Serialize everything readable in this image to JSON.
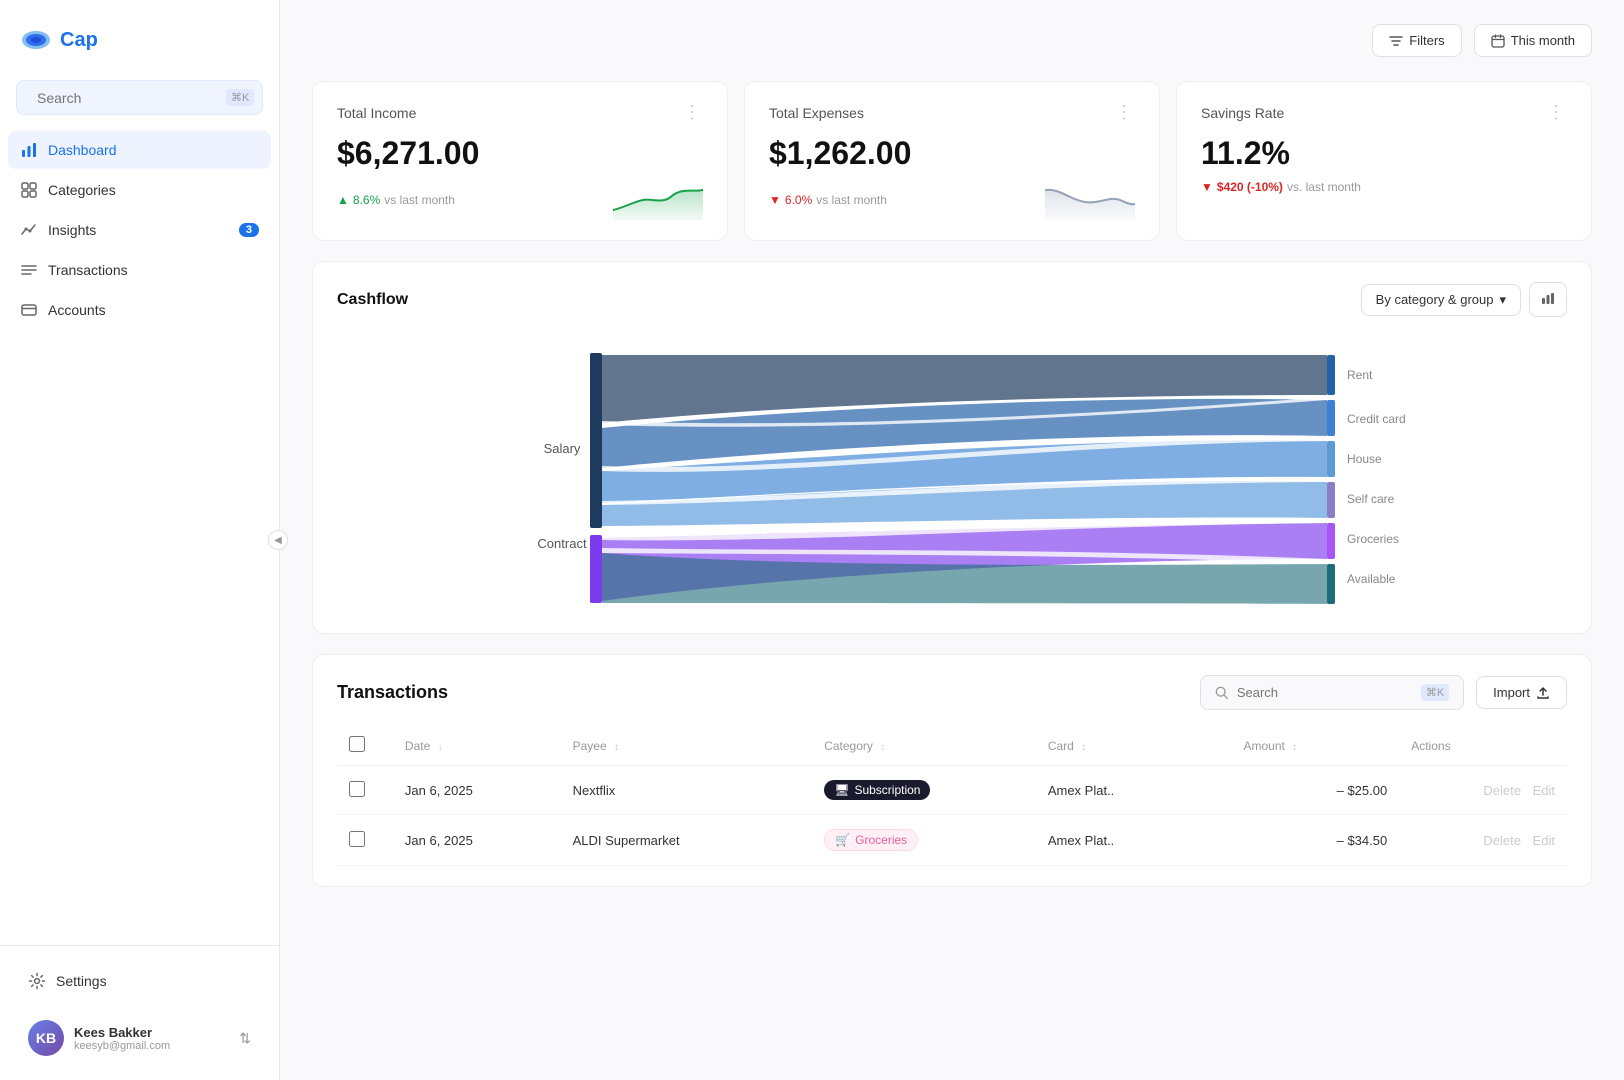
{
  "app": {
    "name": "Cap",
    "logo_color": "#1a73e8"
  },
  "sidebar": {
    "search": {
      "placeholder": "Search",
      "shortcut": "⌘K"
    },
    "nav_items": [
      {
        "id": "dashboard",
        "label": "Dashboard",
        "icon": "bar-chart-icon",
        "active": true,
        "badge": null
      },
      {
        "id": "categories",
        "label": "Categories",
        "icon": "grid-icon",
        "active": false,
        "badge": null
      },
      {
        "id": "insights",
        "label": "Insights",
        "icon": "insights-icon",
        "active": false,
        "badge": "3"
      },
      {
        "id": "transactions",
        "label": "Transactions",
        "icon": "list-icon",
        "active": false,
        "badge": null
      },
      {
        "id": "accounts",
        "label": "Accounts",
        "icon": "card-icon",
        "active": false,
        "badge": null
      }
    ],
    "settings": {
      "label": "Settings",
      "icon": "gear-icon"
    },
    "user": {
      "name": "Kees Bakker",
      "email": "keesyb@gmail.com",
      "initials": "KB"
    }
  },
  "header": {
    "filters_label": "Filters",
    "this_month_label": "This month"
  },
  "stats": [
    {
      "id": "total-income",
      "title": "Total Income",
      "value": "$6,271.00",
      "change": "8.6%",
      "change_direction": "positive",
      "change_prefix": "▲",
      "vs_label": "vs last month",
      "sparkline_color": "#16a34a"
    },
    {
      "id": "total-expenses",
      "title": "Total Expenses",
      "value": "$1,262.00",
      "change": "6.0%",
      "change_direction": "negative",
      "change_prefix": "▼",
      "vs_label": "vs last month",
      "sparkline_color": "#94a3b8"
    },
    {
      "id": "savings-rate",
      "title": "Savings Rate",
      "value": "11.2%",
      "change": "$420 (-10%)",
      "change_direction": "negative",
      "change_prefix": "▼",
      "vs_label": "vs. last month",
      "sparkline_color": null
    }
  ],
  "cashflow": {
    "title": "Cashflow",
    "group_by_label": "By category & group",
    "sources": [
      "Salary",
      "Contract"
    ],
    "targets": [
      "Rent",
      "Credit card",
      "House",
      "Self care",
      "Groceries",
      "Available"
    ],
    "colors": {
      "salary_dark": "#1e3a5f",
      "salary_mid": "#2563a8",
      "salary_light": "#3b82d4",
      "contract_purple": "#7c3aed",
      "contract_violet": "#a855f7",
      "rent": "#2563a8",
      "credit": "#3b82d4",
      "house": "#5b9bd5",
      "self_care": "#8b7ec8",
      "groceries": "#a855f7",
      "available": "#1e6b7a"
    }
  },
  "transactions": {
    "title": "Transactions",
    "search_placeholder": "Search",
    "search_shortcut": "⌘K",
    "import_label": "Import",
    "columns": [
      {
        "id": "date",
        "label": "Date",
        "sortable": true
      },
      {
        "id": "payee",
        "label": "Payee",
        "sortable": true
      },
      {
        "id": "category",
        "label": "Category",
        "sortable": true
      },
      {
        "id": "card",
        "label": "Card",
        "sortable": true
      },
      {
        "id": "amount",
        "label": "Amount",
        "sortable": true
      },
      {
        "id": "actions",
        "label": "Actions",
        "sortable": false
      }
    ],
    "rows": [
      {
        "id": "tx1",
        "date": "Jan 6, 2025",
        "payee": "Nextflix",
        "category": "Subscription",
        "category_type": "subscription",
        "category_icon": "🖥",
        "card": "Amex Plat..",
        "amount": "– $25.00"
      },
      {
        "id": "tx2",
        "date": "Jan 6, 2025",
        "payee": "ALDI Supermarket",
        "category": "Groceries",
        "category_type": "groceries",
        "category_icon": "🛒",
        "card": "Amex Plat..",
        "amount": "– $34.50"
      }
    ]
  }
}
